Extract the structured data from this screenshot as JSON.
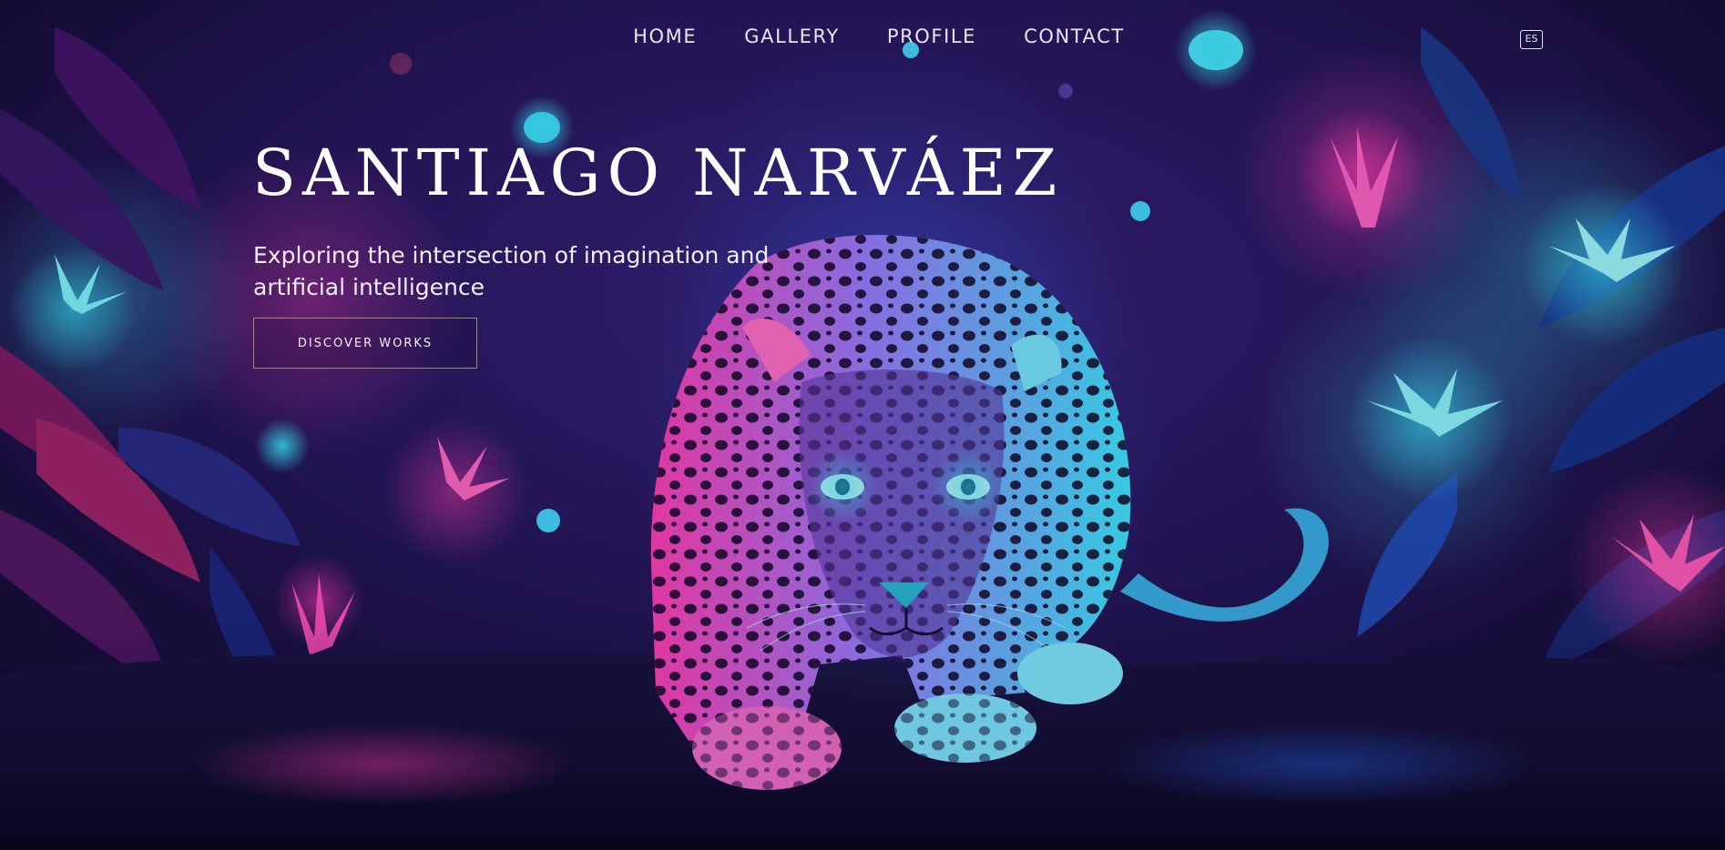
{
  "nav": {
    "items": [
      {
        "label": "HOME"
      },
      {
        "label": "GALLERY"
      },
      {
        "label": "PROFILE"
      },
      {
        "label": "CONTACT"
      }
    ],
    "language_toggle": "ES"
  },
  "hero": {
    "title": "SANTIAGO NARVÁEZ",
    "subtitle": "Exploring the intersection of imagination and artificial intelligence",
    "cta_label": "DISCOVER WORKS"
  },
  "colors": {
    "background": "#140a2a",
    "accent_magenta": "#ff2ea6",
    "accent_cyan": "#2ee6ff",
    "cta_border": "#a08a6a"
  },
  "icons": {
    "background_art": "neon-jaguar-jungle-illustration"
  }
}
